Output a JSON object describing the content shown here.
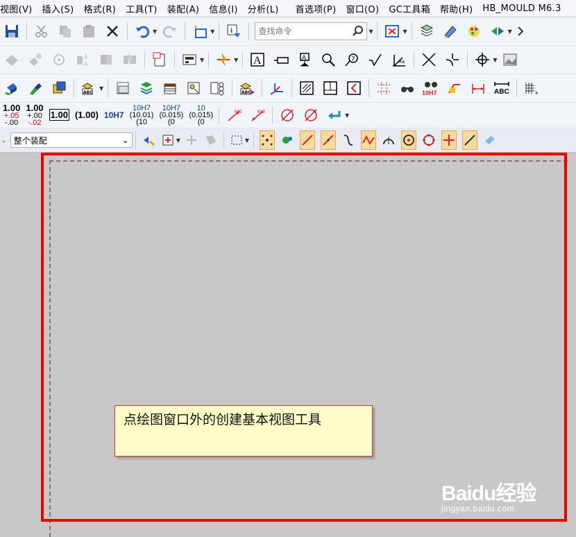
{
  "menubar": {
    "items": [
      "视图(V)",
      "插入(S)",
      "格式(R)",
      "工具(T)",
      "装配(A)",
      "信息(I)",
      "分析(L)",
      "首选项(P)",
      "窗口(O)",
      "GC工具箱",
      "帮助(H)",
      "HB_MOULD M6.3"
    ]
  },
  "toolbar": {
    "search_placeholder": "查找命令",
    "label_abc": "ABC",
    "label_10h7": "10H7"
  },
  "tolerance": [
    {
      "main": "1.00",
      "upper": "+.05",
      "lower": "-.00"
    },
    {
      "main": "1.00",
      "upper": "+.00",
      "lower": "-.02"
    },
    {
      "main": "1.00"
    },
    {
      "main": "(1.00)"
    },
    {
      "main": "10H7"
    },
    {
      "main": "10H7",
      "sub1": "(10.01)",
      "sub2": "(10"
    },
    {
      "main": "10H7",
      "sub1": "(0.015)",
      "sub2": "(0"
    },
    {
      "main": "10",
      "sub1": "(0.015)",
      "sub2": "(0"
    }
  ],
  "selection_bar": {
    "filter_value": "整个装配"
  },
  "callout": {
    "text": "点绘图窗口外的创建基本视图工具"
  },
  "watermark": {
    "brand": "Baidu经验",
    "url": "jingyan.baidu.com"
  },
  "colors": {
    "highlight": "#ee0000",
    "callout_bg": "#fdfdc8",
    "canvas": "#c8c8c8"
  }
}
